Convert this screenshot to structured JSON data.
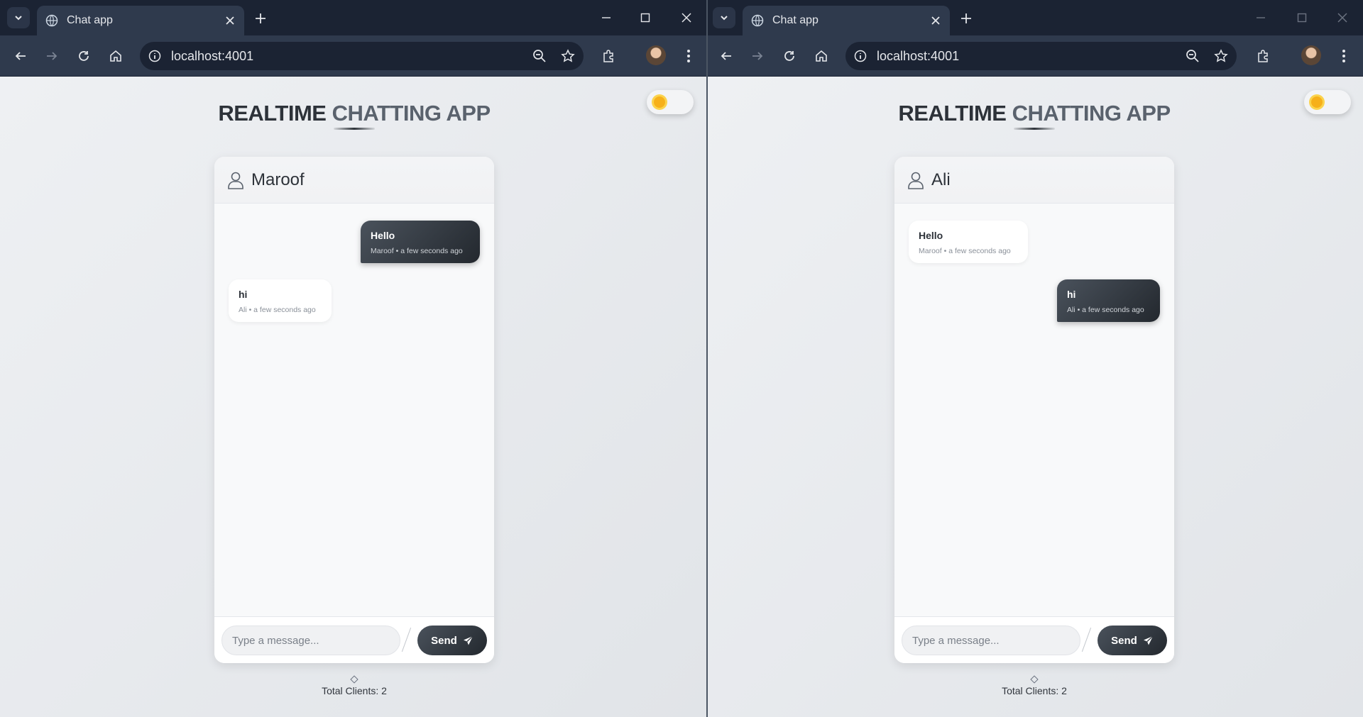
{
  "windows": [
    {
      "tab_title": "Chat app",
      "url": "localhost:4001",
      "app_title_part1": "REALTIME",
      "app_title_part2": "CHATTING APP",
      "username": "Maroof",
      "messages": [
        {
          "text": "Hello",
          "meta": "Maroof • a few seconds ago",
          "mine": true
        },
        {
          "text": "hi",
          "meta": "Ali • a few seconds ago",
          "mine": false
        }
      ],
      "input_placeholder": "Type a message...",
      "send_label": "Send",
      "clients_text": "Total Clients: 2"
    },
    {
      "tab_title": "Chat app",
      "url": "localhost:4001",
      "app_title_part1": "REALTIME",
      "app_title_part2": "CHATTING APP",
      "username": "Ali",
      "messages": [
        {
          "text": "Hello",
          "meta": "Maroof • a few seconds ago",
          "mine": false
        },
        {
          "text": "hi",
          "meta": "Ali • a few seconds ago",
          "mine": true
        }
      ],
      "input_placeholder": "Type a message...",
      "send_label": "Send",
      "clients_text": "Total Clients: 2"
    }
  ],
  "colors": {
    "browser_frame": "#1b2333",
    "toolbar": "#2f3a4d",
    "accent_dark": "#2d3239",
    "sun": "#f6b01a"
  },
  "icons": [
    "tab-search-icon",
    "globe-icon",
    "close-icon",
    "plus-icon",
    "minimize-icon",
    "maximize-icon",
    "back-icon",
    "forward-icon",
    "reload-icon",
    "home-icon",
    "site-info-icon",
    "zoom-icon",
    "star-icon",
    "extensions-icon",
    "menu-icon",
    "user-icon",
    "send-icon",
    "sun-icon"
  ]
}
